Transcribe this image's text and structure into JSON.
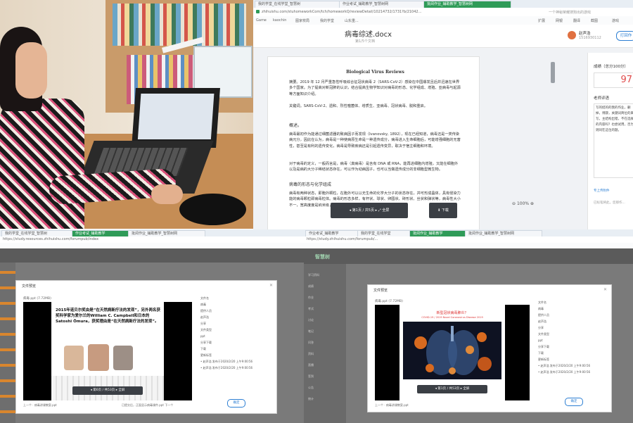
{
  "photo": {
    "alt": "teacher working on laptop"
  },
  "top_browser": {
    "tabs": [
      "我的学堂_在线学堂_智慧树",
      "作业考试_辅助教学_智慧树网",
      "批阅作业_辅助教学_智慧树网"
    ],
    "url": "zhihuishu.com/stuhomeworkCom/tch/homeworkQ/reviewDetail/10214732/1731?b/21042...",
    "search_placeholder": "一个神秘荣耀搜狗出的游戏",
    "bookmarks": [
      "Game",
      "kaochin",
      "图家校局",
      "我的学堂",
      "山东重..."
    ],
    "bookmarks_right": [
      "扩展",
      "网银",
      "翻译",
      "截图",
      "游戏"
    ],
    "doc_title": "病毒综述.docx",
    "doc_subtitle": "第1/5个文档",
    "user_name": "赵声浩",
    "user_id": "1516930112",
    "action_button": "打回作",
    "page_indicator": "第1页 / 共5页",
    "fullscreen_label": "全屏",
    "download_label": "下载",
    "zoom": "100%",
    "score_label": "成绩（总分100分）",
    "score_value": "97",
    "comment_label": "老师评语",
    "comment_text": "写的挺的的我的作业，删掉，博骤，关键词简位的来写，主结构出错，不在选择的内容吗？也尝试用，否为则同在这位的题。",
    "comment_more": "专上传附件",
    "comment_footer": "已标笔将此，您那作..."
  },
  "document": {
    "heading": "Biological Virus Reviews",
    "abstract": "摘要。2019 年 12 月严重急性呼吸综合征冠状病毒 2（SARS-CoV-2）感染在中国爆发且后并迅速在世界多个国家。为了提高对新冠肺的认识，结合提高生物学知识对病毒的形态、化学组成、增殖、亚病毒与起源等方面知识介绍。",
    "keywords": "关键词。SARS-CoV-2、遗和、烈性噬菌体、增质生、亚病毒、冠状病毒、脱和重启。",
    "intro_title": "概述。",
    "intro_p1": "病毒最初作为能通过细菌滤器的致病因子而发现（Ivanovsky, 1892），现在已经知道，病毒还是一类传染病元分，因此在认为，病毒是一种使病原生命是一种遗传成分，病毒进入生命细胞后，可能增强细胞的无害性，甚至是有利的遗传变化，病毒是导致疾病还是引起遗传变异，取决于宿主细胞和环境。",
    "intro_p2": "对于病毒的定义，一般而言是，病毒（真病毒）是含有 DNA 或 RNA，能再进细胞内增殖，又能在细胞外以及是病的大分子稀结状态存在，可以作为动病因子，也可以当做遗传成分的非细胞型微生物。",
    "section2_title": "病毒的形态与化学组成",
    "section2_p1": "病毒有两种状态，即胞外颗粒，在胞外可以以无生命的化学大分子的状态存在，并可形成晶体，具有侵染力能的病毒颗粒即病毒粒体。病毒的形态多样，有杆状、球状、卵圆状、砖形状、丝状和弹状等，病毒性大小不一，宽高度度是纳米级，有的病毒还有囊膜……病毒粒体。"
  },
  "bottom_left": {
    "tabs": [
      "我的学堂_在线学堂_智慧树",
      "作业考试_辅助教学",
      "批阅作业_辅助教学_智慧树网"
    ],
    "url": "https://study.resources.zhihuishu.com/forumpub/index",
    "modal_title": "文件预览",
    "file_name": "病毒.ppt (7.72MB)",
    "slide_text": "2015年诺贝尔奖由是“在天然病新疗法的发现”，另外两名获奖科学家为爱尔兰的William C. Campbell和日本的Satoshi Ōmura，获奖理由是“在天然病新疗法的发现”。",
    "page_indicator": "第6页 / 共53页",
    "fullscreen": "全屏",
    "side_labels": [
      "文件名",
      "病毒",
      "提供人员",
      "赵声浩",
      "分享",
      "文件类型",
      "ppt",
      "分享下载",
      "下载",
      "更新标签",
      "• 赵声浩 发布于2020/2/20 上午9:00:56",
      "• 赵声浩 发布于2020/2/20 上午9:00:56"
    ],
    "footer": "上一个 · 病毒讲课教案.ppt",
    "footer_right": "已提交后，正面显示病毒课件.ppt 下一个",
    "close_btn": "确定"
  },
  "bottom_right": {
    "tabs": [
      "作业考试_辅助教学",
      "我的学堂_在线学堂",
      "批阅作业_辅助教学",
      "批阅作业_辅助教学_智慧树网"
    ],
    "url": "https://study.zhihuishu.com/forumpub/...",
    "brand": "智慧树",
    "modal_title": "文件预览",
    "file_name": "病毒.ppt (7.72MB)",
    "slide_title": "新型冠状病毒肺炎？",
    "slide_subtitle": "COVID-19 / 2019 Novel Coronavirus Disease 2019",
    "page_indicator": "第1页 / 共53页",
    "fullscreen": "全屏",
    "side_labels": [
      "文件名",
      "病毒",
      "提供人员",
      "赵声浩",
      "分享",
      "文件类型",
      "ppt",
      "分享下载",
      "下载",
      "更新标签",
      "• 赵声浩 发布于2020/2/20 上午9:00:56",
      "• 赵声浩 发布于2020/2/20 上午9:00:56"
    ],
    "left_nav": [
      "学习资料",
      "成绩",
      "作业",
      "考试",
      "讨论",
      "笔记",
      "问答",
      "资料",
      "直播",
      "签到",
      "公告",
      "统计"
    ],
    "footer": "上一个 · 病毒讲课教案.ppt",
    "close_btn": "确定"
  },
  "colors": {
    "accent_green": "#2f9b58",
    "score_red": "#e04b4b",
    "link_blue": "#2d7fd3"
  }
}
